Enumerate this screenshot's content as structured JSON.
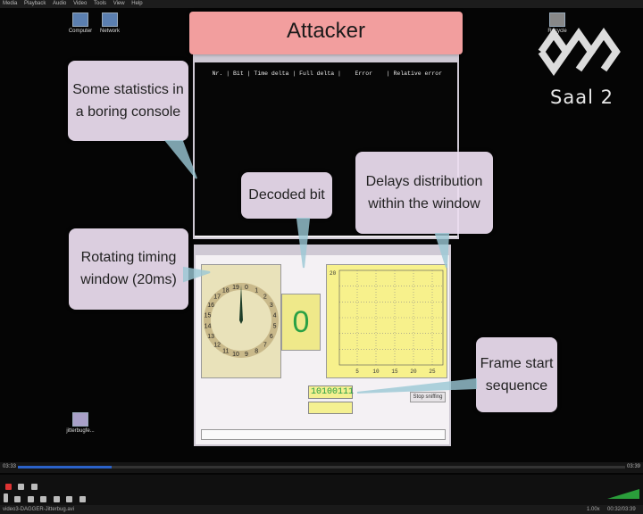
{
  "player": {
    "menu": [
      "Media",
      "Playback",
      "Audio",
      "Video",
      "Tools",
      "View",
      "Help"
    ],
    "time_elapsed": "03:33",
    "time_total": "03:39",
    "progress_fraction": 0.155,
    "filename": "video3-DAGGER-Jitterbug.avi",
    "speed": "1.00x",
    "time_status": "00:32/03:39"
  },
  "desktop": {
    "icons": [
      {
        "label": "Computer"
      },
      {
        "label": "Network"
      },
      {
        "label": "Recycle"
      },
      {
        "label": "jitterbugfe..."
      }
    ]
  },
  "logo": {
    "text": "Saal 2"
  },
  "console_window": {
    "header": "Nr. | Bit | Time delta | Full delta |    Error    | Relative error"
  },
  "gui_window": {
    "clock_numbers": [
      "19",
      "0",
      "1",
      "2",
      "3",
      "4",
      "5",
      "6",
      "7",
      "8",
      "9",
      "10",
      "11",
      "12",
      "13",
      "14",
      "15",
      "16",
      "17",
      "18"
    ],
    "decoded_bit": "0",
    "plot": {
      "y_tick_top": "20",
      "x_ticks": [
        "5",
        "10",
        "15",
        "20",
        "25"
      ]
    },
    "sequence": "10100111",
    "stop_button": "Stop sniffing"
  },
  "callouts": {
    "title": "Attacker",
    "statistics": [
      "Some statistics in",
      "a boring console"
    ],
    "decoded_bit": "Decoded bit",
    "delays": [
      "Delays distribution",
      "within the window"
    ],
    "timing": [
      "Rotating timing",
      "window (20ms)"
    ],
    "frame_start": [
      "Frame start",
      "sequence"
    ]
  },
  "colors": {
    "title_bg": "#f29e9e",
    "callout_bg": "#ecdef0",
    "bit_green": "#2aa145",
    "plot_bg": "#f7f18c",
    "seek_fill": "#2b62c9"
  }
}
